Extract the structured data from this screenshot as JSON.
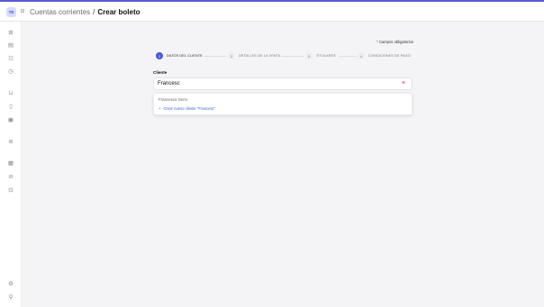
{
  "header": {
    "avatar_initials": "TE",
    "breadcrumb_parent": "Cuentas corrientes",
    "breadcrumb_separator": "/",
    "breadcrumb_current": "Crear boleto"
  },
  "sidebar": {
    "icons": [
      "grid-icon",
      "chart-icon",
      "users-icon",
      "clock-icon",
      "cart-icon",
      "document-icon",
      "archive-icon",
      "settings-circle-icon",
      "modules-icon",
      "tag-icon",
      "building-icon",
      "settings-icon",
      "user-icon"
    ]
  },
  "form": {
    "required_note": "Campos obligatorios",
    "required_mark": "*",
    "steps": [
      {
        "num": "1",
        "label": "DATOS DEL CLIENTE",
        "active": true
      },
      {
        "num": "2",
        "label": "DETALLES DE LA VENTA",
        "active": false
      },
      {
        "num": "3",
        "label": "TITULARES",
        "active": false
      },
      {
        "num": "4",
        "label": "CONDICIONES DE PAGO",
        "active": false
      }
    ],
    "client_label": "Cliente",
    "client_value": "Francesc",
    "clear_glyph": "×",
    "suggestion": "Francesca Serro",
    "create_option_prefix": "+",
    "create_option": "Crear nuevo cliente \"Francesc\""
  },
  "colors": {
    "accent": "#4b5bd6",
    "danger": "#dd2233",
    "link": "#3b5bd6"
  }
}
